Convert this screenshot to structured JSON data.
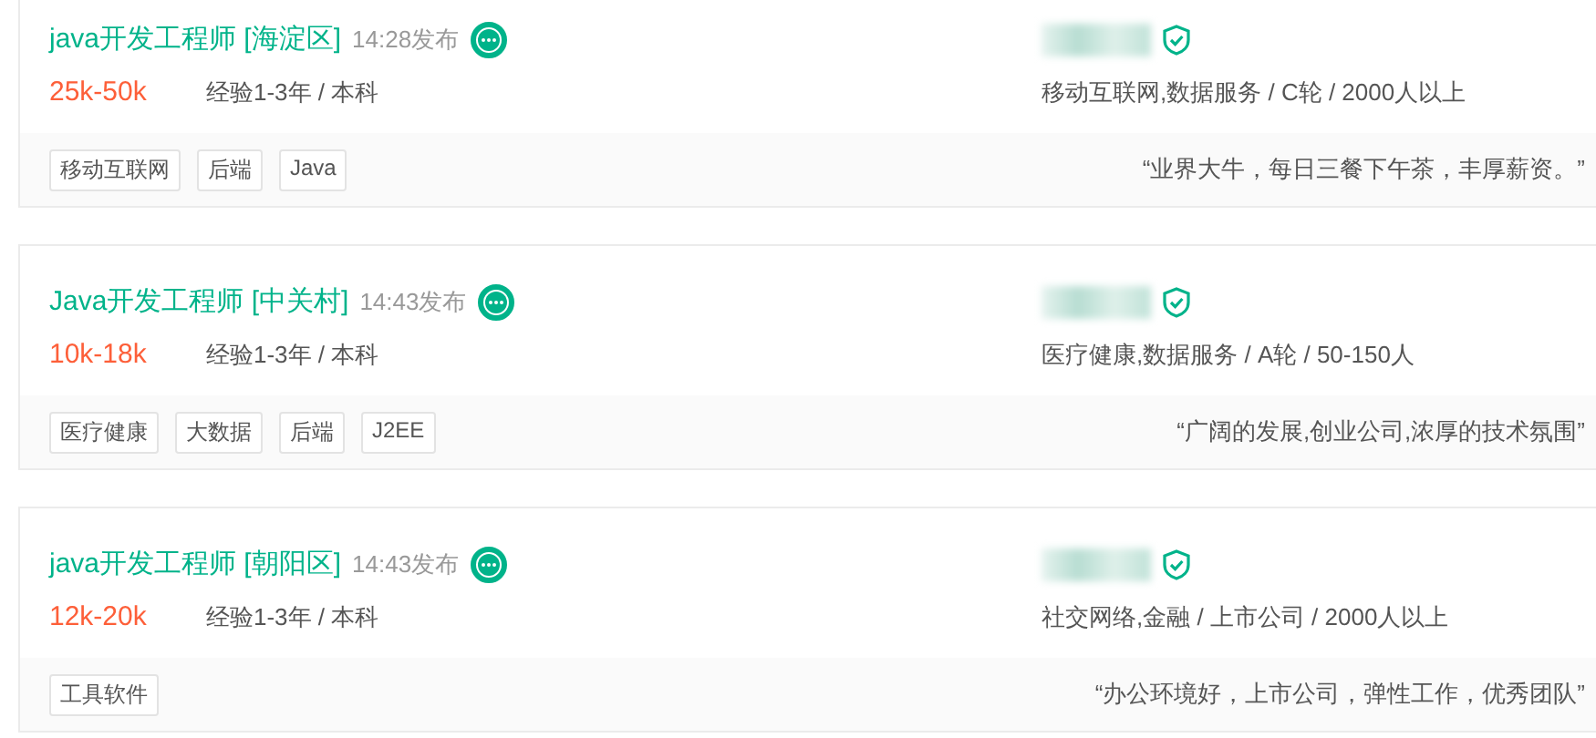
{
  "jobs": [
    {
      "title": "java开发工程师 [海淀区]",
      "time": "14:28发布",
      "salary": "25k-50k",
      "requirements": "经验1-3年 / 本科",
      "company_info": "移动互联网,数据服务 / C轮 / 2000人以上",
      "tags": [
        "移动互联网",
        "后端",
        "Java"
      ],
      "quote": "“业界大牛，每日三餐下午茶，丰厚薪资。”"
    },
    {
      "title": "Java开发工程师 [中关村]",
      "time": "14:43发布",
      "salary": "10k-18k",
      "requirements": "经验1-3年 / 本科",
      "company_info": "医疗健康,数据服务 / A轮 / 50-150人",
      "tags": [
        "医疗健康",
        "大数据",
        "后端",
        "J2EE"
      ],
      "quote": "“广阔的发展,创业公司,浓厚的技术氛围”"
    },
    {
      "title": "java开发工程师 [朝阳区]",
      "time": "14:43发布",
      "salary": "12k-20k",
      "requirements": "经验1-3年 / 本科",
      "company_info": "社交网络,金融 / 上市公司 / 2000人以上",
      "tags": [
        "工具软件"
      ],
      "quote": "“办公环境好，上市公司，弹性工作，优秀团队”"
    }
  ]
}
